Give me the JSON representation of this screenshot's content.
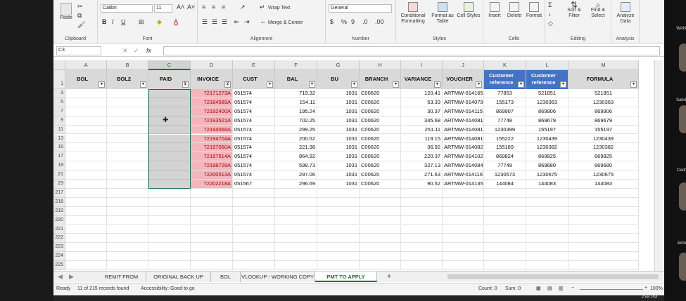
{
  "ribbon": {
    "paste": "Paste",
    "clipboard": "Clipboard",
    "font_name": "Calibri",
    "font_size": "11",
    "font": "Font",
    "wrap_text": "Wrap Text",
    "merge_center": "Merge & Center",
    "alignment": "Alignment",
    "number_format": "General",
    "number": "Number",
    "conditional_formatting": "Conditional Formatting",
    "format_as_table": "Format as Table",
    "cell_styles": "Cell Styles",
    "styles": "Styles",
    "insert": "Insert",
    "delete": "Delete",
    "format": "Format",
    "cells": "Cells",
    "sort_filter": "Sort & Filter",
    "find_select": "Find & Select",
    "editing": "Editing",
    "analyze_data": "Analyze Data",
    "analysis": "Analysis"
  },
  "formula_bar": {
    "name_box": "C3",
    "fx": "fx",
    "content": ""
  },
  "columns": [
    "A",
    "B",
    "C",
    "D",
    "E",
    "F",
    "G",
    "H",
    "I",
    "J",
    "K",
    "L",
    "M"
  ],
  "header_row": {
    "row_num": "1",
    "labels": [
      "BOL",
      "BOL2",
      "PAID",
      "INVOICE",
      "CUST",
      "BAL",
      "BU",
      "BRANCH",
      "VARIANCE",
      "VOUCHER",
      "Customer reference",
      "Customer reference",
      "FORMULA"
    ]
  },
  "rows": [
    {
      "num": "3",
      "invoice": "72171273A",
      "cust": "051574",
      "bal": "719.32",
      "bu": "1031",
      "branch": "C00620",
      "variance": "120.41",
      "voucher": "ARTMW-014165",
      "k": "77853",
      "l": "521851",
      "m": "521851"
    },
    {
      "num": "5",
      "invoice": "72184589A",
      "cust": "051574",
      "bal": "154.11",
      "bu": "1031",
      "branch": "C00620",
      "variance": "53.33",
      "voucher": "ARTMW-014079",
      "k": "155173",
      "l": "1230363",
      "m": "1230363"
    },
    {
      "num": "7",
      "invoice": "72192400A",
      "cust": "051574",
      "bal": "195.24",
      "bu": "1031",
      "branch": "C00620",
      "variance": "30.37",
      "voucher": "ARTMW-014115",
      "k": "869907",
      "l": "869906",
      "m": "869906"
    },
    {
      "num": "9",
      "invoice": "72193521A",
      "cust": "051574",
      "bal": "702.25",
      "bu": "1031",
      "branch": "C00620",
      "variance": "345.68",
      "voucher": "ARTMW-014081",
      "k": "77748",
      "l": "869679",
      "m": "869679"
    },
    {
      "num": "11",
      "invoice": "72194068A",
      "cust": "051574",
      "bal": "299.25",
      "bu": "1031",
      "branch": "C00620",
      "variance": "251.11",
      "voucher": "ARTMW-014081",
      "k": "1230399",
      "l": "155197",
      "m": "155197"
    },
    {
      "num": "13",
      "invoice": "72194704A",
      "cust": "051574",
      "bal": "200.62",
      "bu": "1031",
      "branch": "C00620",
      "variance": "119.15",
      "voucher": "ARTMW-014081",
      "k": "155222",
      "l": "1230439",
      "m": "1230439"
    },
    {
      "num": "15",
      "invoice": "72197060A",
      "cust": "051574",
      "bal": "221.98",
      "bu": "1031",
      "branch": "C00620",
      "variance": "36.92",
      "voucher": "ARTMW-014082",
      "k": "155189",
      "l": "1230382",
      "m": "1230382"
    },
    {
      "num": "17",
      "invoice": "72197514A",
      "cust": "051574",
      "bal": "864.92",
      "bu": "1031",
      "branch": "C00620",
      "variance": "220.37",
      "voucher": "ARTMW-014102",
      "k": "869824",
      "l": "869825",
      "m": "869825"
    },
    {
      "num": "19",
      "invoice": "72198728A",
      "cust": "051574",
      "bal": "598.73",
      "bu": "1031",
      "branch": "C00620",
      "variance": "327.13",
      "voucher": "ARTMW-014084",
      "k": "77749",
      "l": "869680",
      "m": "869680"
    },
    {
      "num": "21",
      "invoice": "72200513A",
      "cust": "051574",
      "bal": "297.06",
      "bu": "1031",
      "branch": "C00620",
      "variance": "271.63",
      "voucher": "ARTMW-014116",
      "k": "1230673",
      "l": "1230675",
      "m": "1230675"
    },
    {
      "num": "23",
      "invoice": "72202218A",
      "cust": "051567",
      "bal": "296.69",
      "bu": "1031",
      "branch": "C00620",
      "variance": "90.52",
      "voucher": "ARTMW-014135",
      "k": "144084",
      "l": "144083",
      "m": "144083"
    }
  ],
  "empty_rows": [
    "217",
    "218",
    "219",
    "220",
    "221",
    "222",
    "223",
    "224",
    "225"
  ],
  "tabs": [
    "REMIT FROM",
    "ORIGINAL BACK UP",
    "BOL",
    "VLOOKUP - WORKING COPY",
    "PMT TO APPLY"
  ],
  "active_tab": "PMT TO APPLY",
  "add_sheet": "+",
  "status": {
    "ready": "Ready",
    "records": "11 of 215 records found",
    "accessibility": "Accessibility: Good to go",
    "count": "Count: 0",
    "sum": "Sum: 0",
    "zoom": "100%"
  },
  "side_labels": [
    "WAN",
    "Sabri",
    "Cedr",
    "John"
  ],
  "taskbar_time": "2:58 PM",
  "colors": {
    "invoice_fill": "#f4b6bc",
    "invoice_text": "#9c0006",
    "header_fill": "#d9d9d9",
    "blue_header": "#4472c4",
    "selected_fill": "#d3d3d3",
    "green": "#1e7145"
  }
}
